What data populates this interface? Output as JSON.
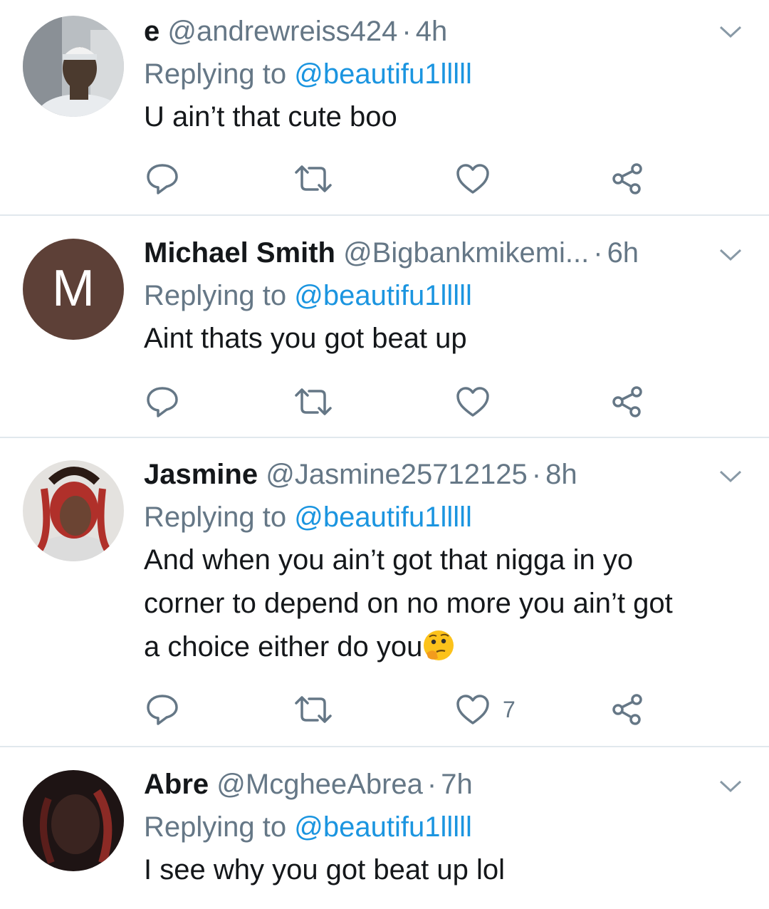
{
  "replies": [
    {
      "display_name": "e",
      "handle": "@andrewreiss424",
      "time": "4h",
      "replying_label": "Replying to",
      "replying_to": "@beautifu1lllll",
      "text": "U ain’t that cute boo",
      "like_count": "",
      "avatar": {
        "type": "photo",
        "colors": [
          "#cfd3d6",
          "#4b3a2e",
          "#e9ecef"
        ]
      }
    },
    {
      "display_name": "Michael Smith",
      "handle": "@Bigbankmikemi...",
      "time": "6h",
      "replying_label": "Replying to",
      "replying_to": "@beautifu1lllll",
      "text": "Aint thats you got beat up",
      "like_count": "",
      "avatar": {
        "type": "letter",
        "letter": "M",
        "color": "#5d4037"
      }
    },
    {
      "display_name": "Jasmine",
      "handle": "@Jasmine25712125",
      "time": "8h",
      "replying_label": "Replying to",
      "replying_to": "@beautifu1lllll",
      "text_lines": [
        "And when you ain’t got that nigga in yo",
        "corner to depend on no more you ain’t got",
        "a choice either do you"
      ],
      "emoji": "thinking-face",
      "like_count": "7",
      "avatar": {
        "type": "photo",
        "colors": [
          "#b0302a",
          "#2a1a14",
          "#dcdcdc"
        ]
      }
    },
    {
      "display_name": "Abre",
      "handle": "@McgheeAbrea",
      "time": "7h",
      "replying_label": "Replying to",
      "replying_to": "@beautifu1lllll",
      "text": "I see why you got beat up lol",
      "avatar": {
        "type": "photo",
        "colors": [
          "#1e1414",
          "#3a2420",
          "#8b2a25"
        ]
      }
    }
  ],
  "icons": [
    "chevron-down-icon",
    "reply-icon",
    "retweet-icon",
    "like-icon",
    "share-icon"
  ],
  "colors": {
    "link": "#1b95e0",
    "muted": "#657786",
    "divider": "#e1e8ed"
  }
}
